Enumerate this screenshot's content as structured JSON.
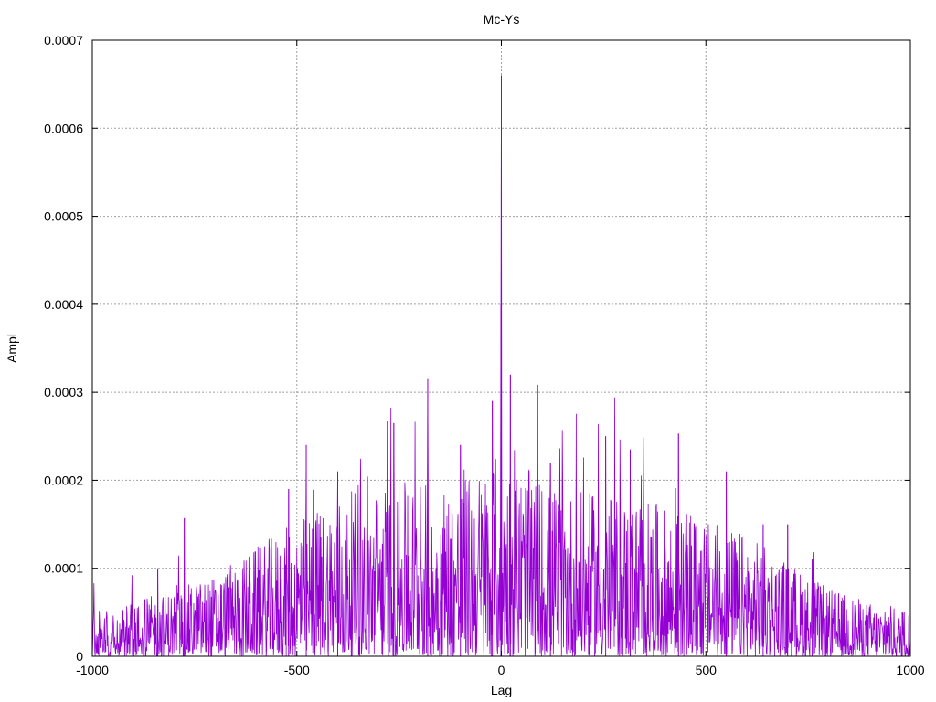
{
  "chart_data": {
    "type": "line",
    "title": "Mc-Ys",
    "xlabel": "Lag",
    "ylabel": "Ampl",
    "xlim": [
      -1000,
      1000
    ],
    "ylim": [
      0,
      0.0007
    ],
    "x_ticks": [
      {
        "value": -1000,
        "label": "-1000"
      },
      {
        "value": -500,
        "label": "-500"
      },
      {
        "value": 0,
        "label": "0"
      },
      {
        "value": 500,
        "label": "500"
      },
      {
        "value": 1000,
        "label": "1000"
      }
    ],
    "y_ticks": [
      {
        "value": 0,
        "label": "0"
      },
      {
        "value": 0.0001,
        "label": "0.0001"
      },
      {
        "value": 0.0002,
        "label": "0.0002"
      },
      {
        "value": 0.0003,
        "label": "0.0003"
      },
      {
        "value": 0.0004,
        "label": "0.0004"
      },
      {
        "value": 0.0005,
        "label": "0.0005"
      },
      {
        "value": 0.0006,
        "label": "0.0006"
      },
      {
        "value": 0.0007,
        "label": "0.0007"
      }
    ],
    "grid": true,
    "colors": {
      "series": "#9400d3",
      "grid": "#a0a0a0",
      "axis": "#000000"
    },
    "series": [
      {
        "envelope": {
          "x": [
            -1000,
            -900,
            -800,
            -700,
            -600,
            -500,
            -400,
            -300,
            -200,
            -100,
            -50,
            0,
            50,
            100,
            200,
            300,
            400,
            500,
            600,
            700,
            800,
            900,
            1000
          ],
          "y": [
            3.5e-05,
            4e-05,
            5e-05,
            6e-05,
            8e-05,
            0.0001,
            0.00012,
            0.000125,
            0.00013,
            0.00013,
            0.00014,
            0.00015,
            0.00014,
            0.00013,
            0.00012,
            0.00012,
            0.00011,
            0.0001,
            9e-05,
            7e-05,
            5e-05,
            4e-05,
            3.5e-05
          ]
        },
        "peaks": [
          {
            "x": 0,
            "y": 0.00066
          },
          {
            "x": -1,
            "y": 0.0004
          },
          {
            "x": -22,
            "y": 0.00029
          },
          {
            "x": 22,
            "y": 0.00032
          },
          {
            "x": -180,
            "y": 0.000315
          },
          {
            "x": -263,
            "y": 0.000265
          },
          {
            "x": -477,
            "y": 0.00024
          },
          {
            "x": -520,
            "y": 0.00019
          },
          {
            "x": -775,
            "y": 0.000157
          },
          {
            "x": -840,
            "y": 0.0001
          },
          {
            "x": 433,
            "y": 0.000253
          },
          {
            "x": 255,
            "y": 0.00025
          },
          {
            "x": 315,
            "y": 0.000235
          },
          {
            "x": -100,
            "y": 0.00024
          },
          {
            "x": 120,
            "y": 0.00022
          },
          {
            "x": -400,
            "y": 0.00021
          },
          {
            "x": 550,
            "y": 0.00021
          },
          {
            "x": 640,
            "y": 0.00015
          },
          {
            "x": 700,
            "y": 0.00015
          },
          {
            "x": 760,
            "y": 0.00011
          },
          {
            "x": 980,
            "y": 5e-05
          }
        ]
      }
    ]
  }
}
